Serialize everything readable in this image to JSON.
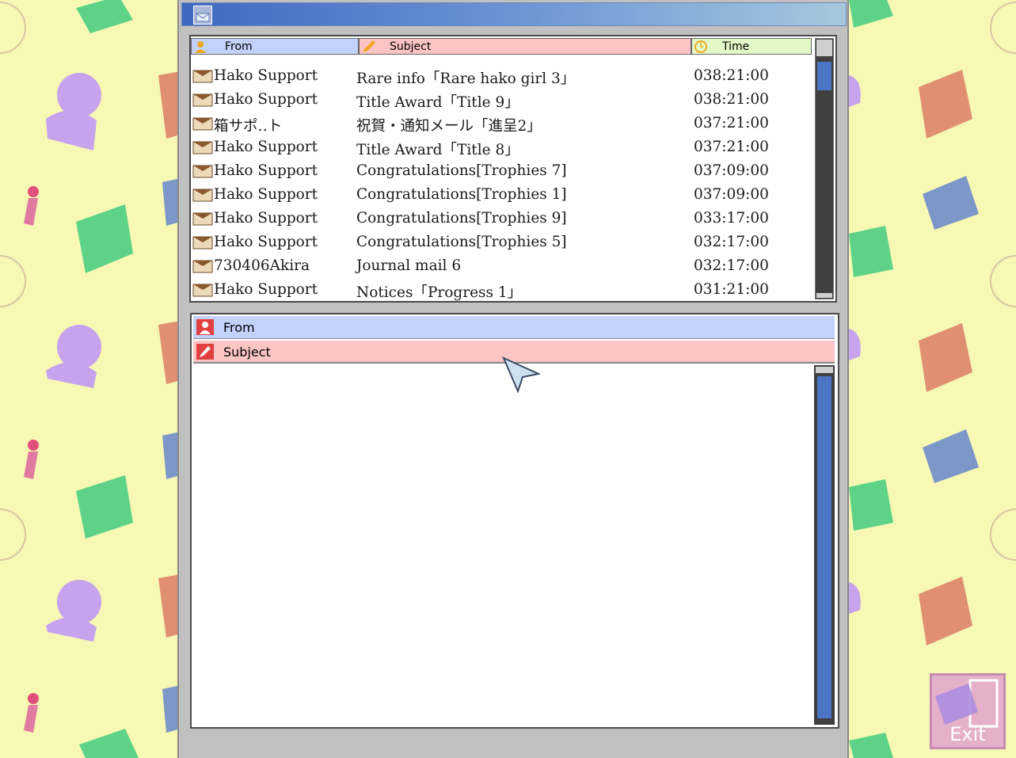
{
  "window": {
    "title_icon": "mail-icon"
  },
  "inbox": {
    "columns": [
      {
        "label": "From",
        "icon": "person-icon"
      },
      {
        "label": "Subject",
        "icon": "pencil-icon"
      },
      {
        "label": "Time",
        "icon": "clock-icon"
      }
    ],
    "rows": [
      {
        "from": "Hako Support",
        "subject": "Rare info「Rare hako girl 3」",
        "time": "038:21:00"
      },
      {
        "from": "Hako Support",
        "subject": "Title Award「Title 9」",
        "time": "038:21:00"
      },
      {
        "from": "箱サポ‥ト",
        "subject": "祝賀・通知メール「進呈2」",
        "time": "037:21:00"
      },
      {
        "from": "Hako Support",
        "subject": "Title Award「Title 8」",
        "time": "037:21:00"
      },
      {
        "from": "Hako Support",
        "subject": "Congratulations[Trophies 7]",
        "time": "037:09:00"
      },
      {
        "from": "Hako Support",
        "subject": "Congratulations[Trophies 1]",
        "time": "037:09:00"
      },
      {
        "from": "Hako Support",
        "subject": "Congratulations[Trophies 9]",
        "time": "033:17:00"
      },
      {
        "from": "Hako Support",
        "subject": "Congratulations[Trophies 5]",
        "time": "032:17:00"
      },
      {
        "from": "730406Akira",
        "subject": "Journal mail 6",
        "time": "032:17:00"
      },
      {
        "from": "Hako Support",
        "subject": "Notices「Progress 1」",
        "time": "031:21:00"
      }
    ]
  },
  "detail": {
    "from_label": "From",
    "subject_label": "Subject"
  },
  "exit": {
    "label": "Exit"
  },
  "colors": {
    "background": "#f6f8b4",
    "from_header": "#c3d2fa",
    "subject_header": "#fcc4c4",
    "time_header": "#e2f8c6",
    "scroll_thumb": "#4b74c4",
    "title_bar_start": "#3f69c0",
    "title_bar_end": "#a6c8de"
  }
}
